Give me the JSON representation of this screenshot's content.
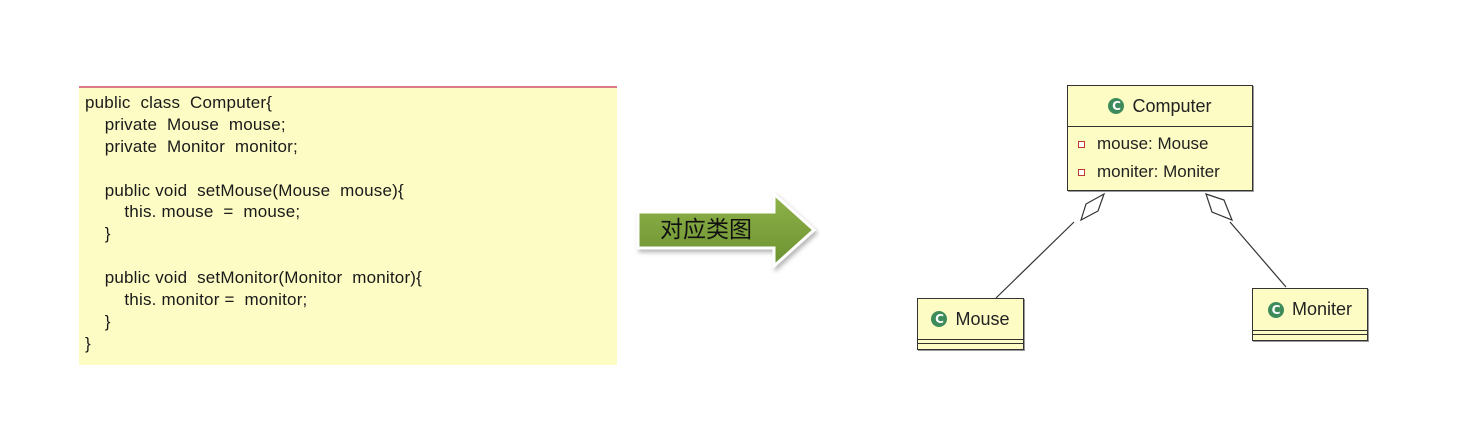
{
  "code": {
    "lines": [
      "public  class  Computer{",
      "    private  Mouse  mouse;",
      "    private  Monitor  monitor;",
      "",
      "    public void  setMouse(Mouse  mouse){",
      "        this. mouse  =  mouse;",
      "    }",
      "",
      "    public void  setMonitor(Monitor  monitor){",
      "        this. monitor =  monitor;",
      "    }",
      "}"
    ],
    "background": "#fcfcc4"
  },
  "arrow": {
    "label": "对应类图",
    "fill": "#7ea23a"
  },
  "diagram": {
    "computer": {
      "name": "Computer",
      "icon": "class-icon",
      "fields": [
        {
          "icon": "private-field-icon",
          "text": "mouse: Mouse"
        },
        {
          "icon": "private-field-icon",
          "text": "moniter: Moniter"
        }
      ]
    },
    "mouse": {
      "name": "Mouse",
      "icon": "class-icon"
    },
    "moniter": {
      "name": "Moniter",
      "icon": "class-icon"
    },
    "relations": [
      {
        "type": "aggregation",
        "from": "Computer",
        "to": "Mouse"
      },
      {
        "type": "aggregation",
        "from": "Computer",
        "to": "Moniter"
      }
    ]
  }
}
